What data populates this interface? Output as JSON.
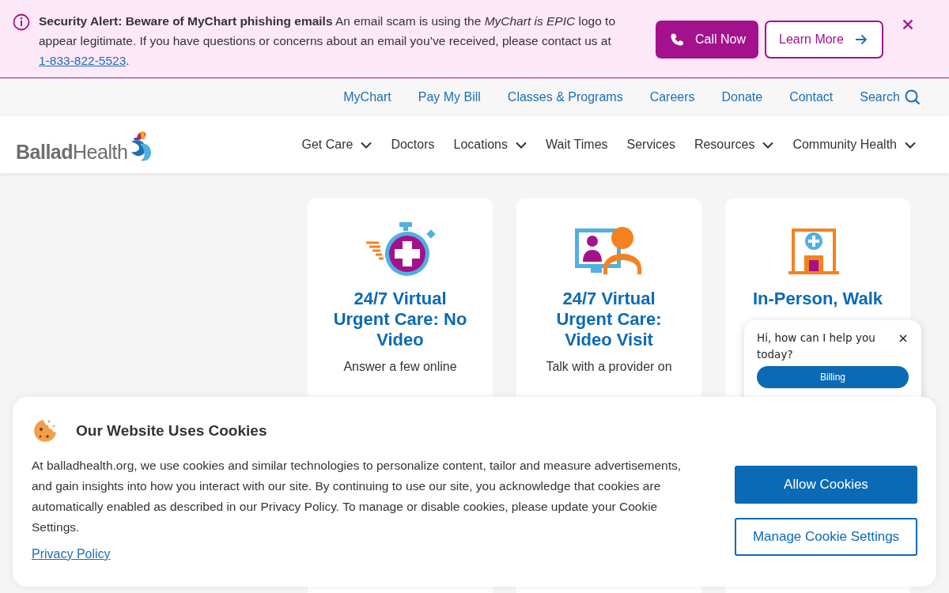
{
  "alert": {
    "message": "**Security Alert: Beware of MyChart phishing emails** An email scam is using the *MyChart is EPIC* logo to appear legitimate. If you have questions or concerns about an email you’ve received, please contact us at",
    "phone": "1-833-822-5523",
    "end": ".",
    "buttons": [
      {
        "label": "Call Now",
        "kind": "call"
      },
      {
        "label": "Learn More",
        "kind": "more"
      }
    ]
  },
  "utility_nav": [
    {
      "label": "MyChart"
    },
    {
      "label": "Pay My Bill"
    },
    {
      "label": "Classes & Programs"
    },
    {
      "label": "Careers"
    },
    {
      "label": "Donate"
    },
    {
      "label": "Contact"
    }
  ],
  "search": {
    "label": "Search"
  },
  "logo": {
    "text": "**Ballad**Health"
  },
  "main_nav": [
    {
      "label": "Get Care",
      "dropdown": true
    },
    {
      "label": "Doctors",
      "dropdown": false
    },
    {
      "label": "Locations",
      "dropdown": true
    },
    {
      "label": "Wait Times",
      "dropdown": false
    },
    {
      "label": "Services",
      "dropdown": false
    },
    {
      "label": "Resources",
      "dropdown": true
    },
    {
      "label": "Community Health",
      "dropdown": true
    }
  ],
  "cards": [
    {
      "kind": "stopwatch",
      "title": "24/7 Virtual Urgent Care: No Video",
      "text": "Answer a few online"
    },
    {
      "kind": "video",
      "title": "24/7 Virtual Urgent Care: Video Visit",
      "text": "Talk with a provider on"
    },
    {
      "kind": "clinic",
      "title": "In-Person, Walk"
    }
  ],
  "chat": {
    "message": "Hi, how can I help you today?",
    "button": "Billing"
  },
  "cookie_banner": {
    "title": "Our Website Uses Cookies",
    "text": "At balladhealth.org, we use cookies and similar technologies to personalize content, tailor and measure advertisements, and gain insights into how you interact with our site. By continuing to use our site, you acknowledge that cookies are automatically enabled as described in our Privacy Policy. To manage or disable cookies, please update your Cookie Settings.",
    "link": "Privacy Policy",
    "buttons": [
      {
        "label": "Allow Cookies",
        "kind": "primary"
      },
      {
        "label": "Manage Cookie Settings",
        "kind": "secondary"
      }
    ]
  }
}
